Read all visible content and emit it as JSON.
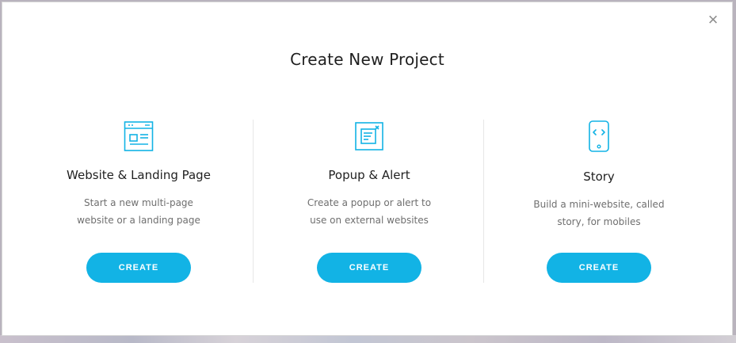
{
  "modal": {
    "title": "Create New Project",
    "close_label": "×"
  },
  "cards": [
    {
      "title": "Website & Landing Page",
      "description": "Start a new multi-page website or a landing page",
      "button_label": "CREATE",
      "icon": "website-icon"
    },
    {
      "title": "Popup & Alert",
      "description": "Create a popup or alert to use on external websites",
      "button_label": "CREATE",
      "icon": "popup-icon"
    },
    {
      "title": "Story",
      "description": "Build a mini-website, called story, for mobiles",
      "button_label": "CREATE",
      "icon": "mobile-story-icon"
    }
  ],
  "colors": {
    "accent": "#12b3e5",
    "title_text": "#1f1f1f",
    "description_text": "#6f6f6f"
  }
}
